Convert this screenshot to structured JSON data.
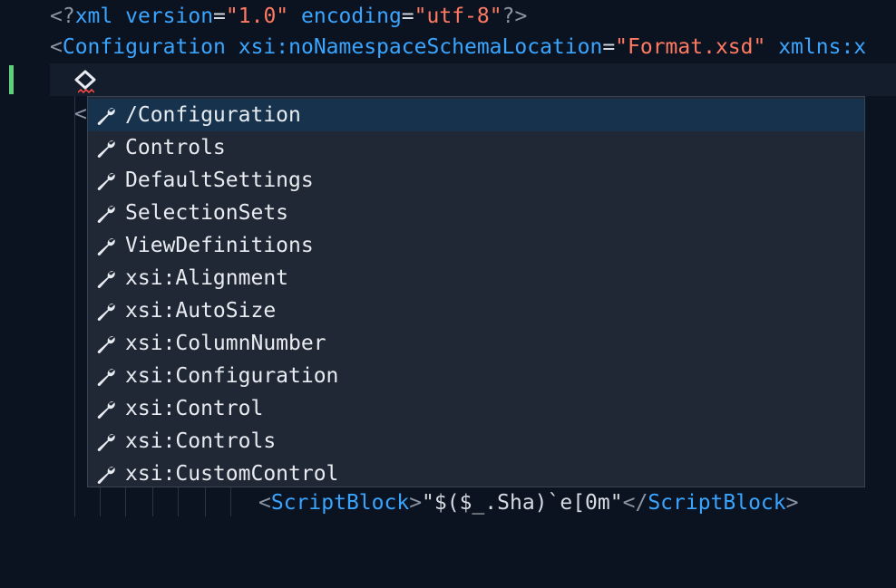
{
  "editor": {
    "line1": {
      "open": "<?",
      "name": "xml",
      "attr1": "version",
      "eq1": "=",
      "val1": "\"1.0\"",
      "attr2": "encoding",
      "eq2": "=",
      "val2": "\"utf-8\"",
      "close": "?>"
    },
    "line2": {
      "open": "<",
      "name": "Configuration",
      "attr1": "xsi:noNamespaceSchemaLocation",
      "eq1": "=",
      "val1": "\"Format.xsd\"",
      "attr2": "xmlns:x"
    },
    "partial_tag": "<",
    "last_line": {
      "open": "<",
      "name": "ScriptBlock",
      "gt": ">",
      "text": "\"$($_.Sha)`e[0m\"",
      "close_open": "</",
      "close_name": "ScriptBlock",
      "close_gt": ">"
    }
  },
  "suggestions": {
    "icon": "wrench-icon",
    "items": [
      "/Configuration",
      "Controls",
      "DefaultSettings",
      "SelectionSets",
      "ViewDefinitions",
      "xsi:Alignment",
      "xsi:AutoSize",
      "xsi:ColumnNumber",
      "xsi:Configuration",
      "xsi:Control",
      "xsi:Controls",
      "xsi:CustomControl"
    ],
    "selected_index": 0
  },
  "colors": {
    "background": "#0b1320",
    "tag": "#3aa5ff",
    "string": "#ff7a62",
    "punctuation": "#8b95a3",
    "selection": "#16324d",
    "gutter_modified": "#5fd07a"
  }
}
